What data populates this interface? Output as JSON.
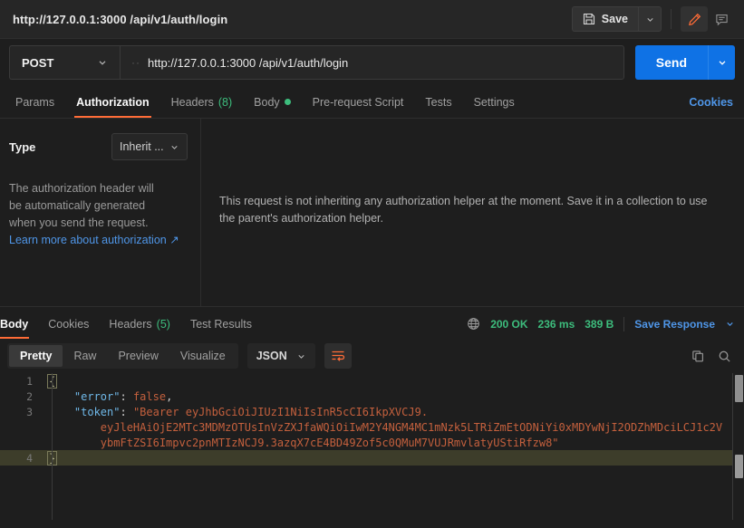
{
  "window": {
    "tab_title": "http://127.0.0.1:3000 /api/v1/auth/login",
    "save_label": "Save"
  },
  "request": {
    "method": "POST",
    "url": "http://127.0.0.1:3000 /api/v1/auth/login",
    "url_prefix_dots": "··",
    "send_label": "Send",
    "tabs": [
      {
        "label": "Params",
        "count": "",
        "dot": false,
        "active": false
      },
      {
        "label": "Authorization",
        "count": "",
        "dot": false,
        "active": true
      },
      {
        "label": "Headers",
        "count": "(8)",
        "dot": false,
        "active": false
      },
      {
        "label": "Body",
        "count": "",
        "dot": true,
        "active": false
      },
      {
        "label": "Pre-request Script",
        "count": "",
        "dot": false,
        "active": false
      },
      {
        "label": "Tests",
        "count": "",
        "dot": false,
        "active": false
      },
      {
        "label": "Settings",
        "count": "",
        "dot": false,
        "active": false
      }
    ],
    "cookies_label": "Cookies"
  },
  "authorization": {
    "type_label": "Type",
    "type_value": "Inherit ...",
    "description": "The authorization header will be automatically generated when you send the request.",
    "learn_more": "Learn more about authorization",
    "learn_more_arrow": "↗",
    "inherit_note": "This request is not inheriting any authorization helper at the moment. Save it in a collection to use the parent's authorization helper."
  },
  "response": {
    "tabs": [
      {
        "label": "Body",
        "count": "",
        "active": true
      },
      {
        "label": "Cookies",
        "count": "",
        "active": false
      },
      {
        "label": "Headers",
        "count": "(5)",
        "active": false
      },
      {
        "label": "Test Results",
        "count": "",
        "active": false
      }
    ],
    "status": "200 OK",
    "time": "236 ms",
    "size": "389 B",
    "save_response": "Save Response",
    "view_modes": [
      {
        "label": "Pretty",
        "active": true
      },
      {
        "label": "Raw",
        "active": false
      },
      {
        "label": "Preview",
        "active": false
      },
      {
        "label": "Visualize",
        "active": false
      }
    ],
    "format": "JSON",
    "body_lines": [
      {
        "num": "1",
        "segments": [
          {
            "text": "{",
            "cls": "brace-box brace"
          }
        ],
        "highlight": false
      },
      {
        "num": "2",
        "segments": [
          {
            "text": "    ",
            "cls": "p"
          },
          {
            "text": "\"error\"",
            "cls": "k"
          },
          {
            "text": ": ",
            "cls": "p"
          },
          {
            "text": "false",
            "cls": "v"
          },
          {
            "text": ",",
            "cls": "p"
          }
        ],
        "highlight": false
      },
      {
        "num": "3",
        "segments": [
          {
            "text": "    ",
            "cls": "p"
          },
          {
            "text": "\"token\"",
            "cls": "k"
          },
          {
            "text": ": ",
            "cls": "p"
          },
          {
            "text": "\"Bearer eyJhbGciOiJIUzI1NiIsInR5cCI6IkpXVCJ9.",
            "cls": "v"
          }
        ],
        "highlight": false
      },
      {
        "num": "",
        "segments": [
          {
            "text": "        eyJleHAiOjE2MTc3MDMzOTUsInVzZXJfaWQiOiIwM2Y4NGM4MC1mNzk5LTRiZmEtODNiYi0xMDYwNjI2ODZhMDciLCJ1c2V",
            "cls": "v"
          }
        ],
        "highlight": false
      },
      {
        "num": "",
        "segments": [
          {
            "text": "        ybmFtZSI6Impvc2pnMTIzNCJ9.3azqX7cE4BD49Zof5c0QMuM7VUJRmvlatyUStiRfzw8\"",
            "cls": "v"
          }
        ],
        "highlight": false
      },
      {
        "num": "4",
        "segments": [
          {
            "text": "}",
            "cls": "brace-box brace"
          }
        ],
        "highlight": true
      }
    ]
  },
  "colors": {
    "accent_orange": "#ff6c37",
    "send_blue": "#0f72e5",
    "link_blue": "#4f96e8",
    "status_green": "#3dbd7d",
    "bg": "#1e1e1e",
    "panel": "#262626"
  }
}
